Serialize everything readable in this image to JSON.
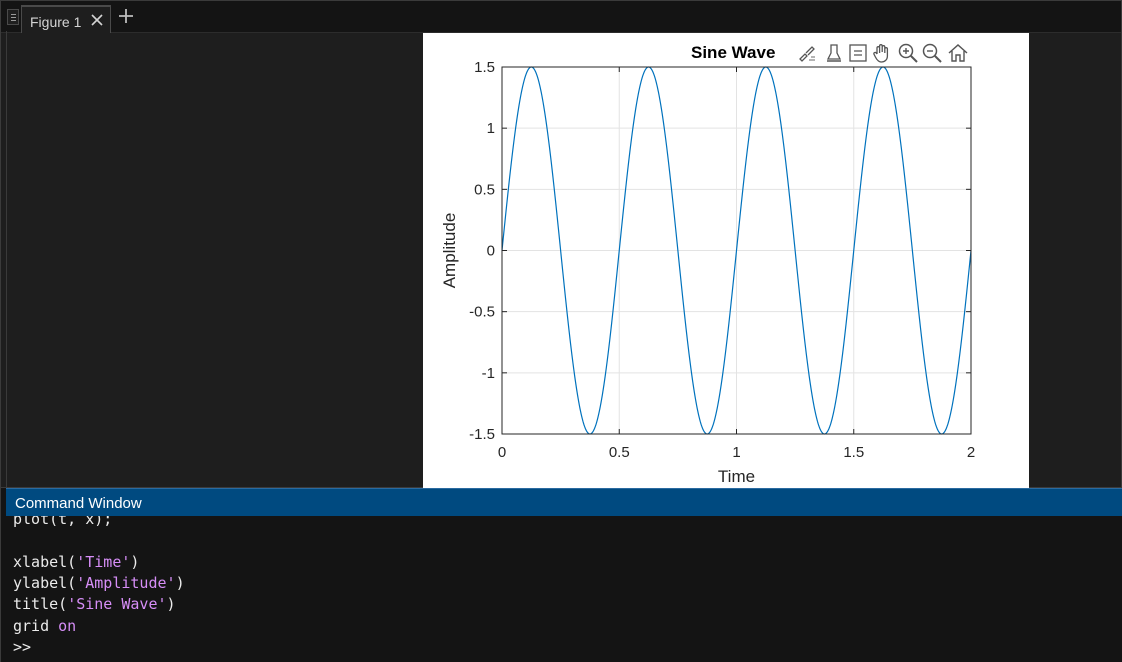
{
  "figure": {
    "tab_label": "Figure 1",
    "icons": {
      "grip": "panel-grip-icon",
      "close": "close-icon",
      "add": "plus-icon"
    },
    "toolbar_icons": [
      "brush-data-icon",
      "data-tips-icon",
      "legend-icon",
      "pan-hand-icon",
      "zoom-in-icon",
      "zoom-out-icon",
      "home-icon"
    ]
  },
  "chart_data": {
    "type": "line",
    "title": "Sine Wave",
    "xlabel": "Time",
    "ylabel": "Amplitude",
    "xlim": [
      0,
      2
    ],
    "ylim": [
      -1.5,
      1.5
    ],
    "xticks": [
      "0",
      "0.5",
      "1",
      "1.5",
      "2"
    ],
    "yticks": [
      "1.5",
      "1",
      "0.5",
      "0",
      "-0.5",
      "-1",
      "-1.5"
    ],
    "grid": true,
    "series": [
      {
        "function": "1.5*sin(2*pi*2*t)",
        "amplitude": 1.5,
        "frequency": 2,
        "t_start": 0,
        "t_end": 2,
        "color": "#0072bd"
      }
    ]
  },
  "command_window": {
    "title": "Command Window",
    "lines": [
      {
        "segments": [
          {
            "text": "plot(t, x);",
            "kind": "code"
          }
        ]
      },
      {
        "segments": [
          {
            "text": "",
            "kind": "code"
          }
        ]
      },
      {
        "segments": [
          {
            "text": "xlabel(",
            "kind": "code"
          },
          {
            "text": "'Time'",
            "kind": "str"
          },
          {
            "text": ")",
            "kind": "code"
          }
        ]
      },
      {
        "segments": [
          {
            "text": "ylabel(",
            "kind": "code"
          },
          {
            "text": "'Amplitude'",
            "kind": "str"
          },
          {
            "text": ")",
            "kind": "code"
          }
        ]
      },
      {
        "segments": [
          {
            "text": "title(",
            "kind": "code"
          },
          {
            "text": "'Sine Wave'",
            "kind": "str"
          },
          {
            "text": ")",
            "kind": "code"
          }
        ]
      },
      {
        "segments": [
          {
            "text": "grid ",
            "kind": "code"
          },
          {
            "text": "on",
            "kind": "kw"
          }
        ]
      },
      {
        "segments": [
          {
            "text": ">>",
            "kind": "code"
          }
        ]
      }
    ]
  },
  "colors": {
    "accent_header": "#004a80",
    "string_literal": "#d68ef7",
    "line": "#0072bd"
  }
}
